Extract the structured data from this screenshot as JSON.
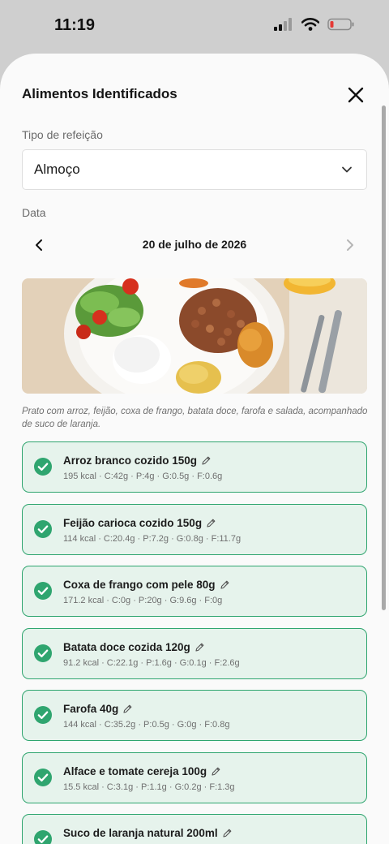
{
  "status": {
    "time": "11:19"
  },
  "header": {
    "title": "Alimentos Identificados"
  },
  "meal": {
    "label": "Tipo de refeição",
    "value": "Almoço"
  },
  "date": {
    "label": "Data",
    "value": "20 de julho de 2026"
  },
  "description": "Prato com arroz, feijão, coxa de frango, batata doce, farofa e salada, acompanhado de suco de laranja.",
  "foods": [
    {
      "name": "Arroz branco cozido 150g",
      "macros": "195 kcal · C:42g · P:4g · G:0.5g · F:0.6g"
    },
    {
      "name": "Feijão carioca cozido 150g",
      "macros": "114 kcal · C:20.4g · P:7.2g · G:0.8g · F:11.7g"
    },
    {
      "name": "Coxa de frango com pele 80g",
      "macros": "171.2 kcal · C:0g · P:20g · G:9.6g · F:0g"
    },
    {
      "name": "Batata doce cozida 120g",
      "macros": "91.2 kcal · C:22.1g · P:1.6g · G:0.1g · F:2.6g"
    },
    {
      "name": "Farofa 40g",
      "macros": "144 kcal · C:35.2g · P:0.5g · G:0g · F:0.8g"
    },
    {
      "name": "Alface e tomate cereja 100g",
      "macros": "15.5 kcal · C:3.1g · P:1.1g · G:0.2g · F:1.3g"
    },
    {
      "name": "Suco de laranja natural 200ml",
      "macros": ""
    }
  ],
  "colors": {
    "accent": "#2fa56f",
    "card_bg": "#e6f3ec",
    "sheet_bg": "#fafafa",
    "backdrop": "#cfcfcf"
  }
}
